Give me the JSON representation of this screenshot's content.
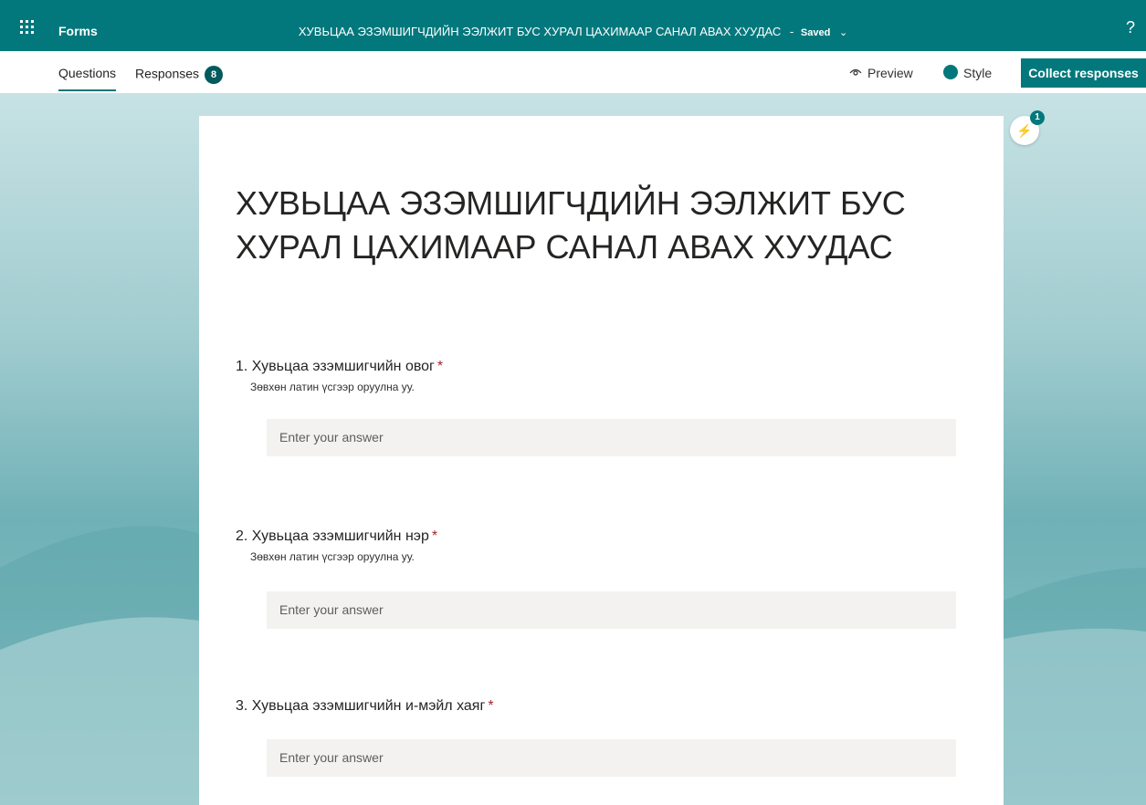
{
  "topbar": {
    "app_name": "Forms",
    "form_title": "ХУВЬЦАА ЭЗЭМШИГЧДИЙН ЭЭЛЖИТ БУС ХУРАЛ ЦАХИМААР САНАЛ АВАХ ХУУДАС",
    "separator": "-",
    "saved_label": "Saved",
    "help": "?"
  },
  "tabs": {
    "questions": "Questions",
    "responses": "Responses",
    "responses_count": "8"
  },
  "toolbar": {
    "preview": "Preview",
    "style": "Style",
    "collect": "Collect responses"
  },
  "insight_count": "1",
  "form": {
    "title": "ХУВЬЦАА ЭЗЭМШИГЧДИЙН ЭЭЛЖИТ БУС ХУРАЛ ЦАХИМААР САНАЛ АВАХ ХУУДАС",
    "questions": [
      {
        "title": "1. Хувьцаа эзэмшигчийн овог",
        "required": "*",
        "subtitle": "Зөвхөн латин үсгээр оруулна уу.",
        "placeholder": "Enter your answer"
      },
      {
        "title": "2. Хувьцаа эзэмшигчийн нэр",
        "required": "*",
        "subtitle": "Зөвхөн латин үсгээр оруулна уу.",
        "placeholder": "Enter your answer"
      },
      {
        "title": "3. Хувьцаа эзэмшигчийн и-мэйл хаяг",
        "required": "*",
        "placeholder": "Enter your answer"
      }
    ]
  },
  "colors": {
    "brand": "#03787c",
    "required": "#a4262c"
  }
}
